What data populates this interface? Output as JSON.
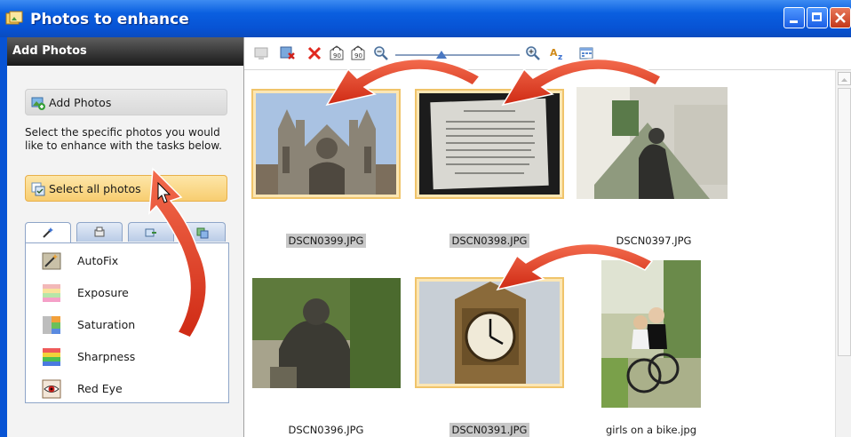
{
  "window": {
    "title": "Photos to enhance"
  },
  "left_panel": {
    "header": "Add Photos",
    "add_photos_label": "Add Photos",
    "description": "Select the specific photos you would like to enhance with the tasks below.",
    "select_all_label": "Select all photos",
    "tasks": [
      "AutoFix",
      "Exposure",
      "Saturation",
      "Sharpness",
      "Red Eye"
    ]
  },
  "photos": [
    {
      "name": "DSCN0399.JPG",
      "selected": true
    },
    {
      "name": "DSCN0398.JPG",
      "selected": true
    },
    {
      "name": "DSCN0397.JPG",
      "selected": false
    },
    {
      "name": "DSCN0396.JPG",
      "selected": false
    },
    {
      "name": "DSCN0391.JPG",
      "selected": true
    },
    {
      "name": "girls on a bike.jpg",
      "selected": false
    }
  ],
  "colors": {
    "title_bar": "#0753d4",
    "selection": "#f0c46a",
    "arrow": "#e8432a"
  },
  "icons": [
    "photo-icon",
    "remove-icon",
    "delete-icon",
    "rotate-left-icon",
    "rotate-right-icon",
    "zoom-out-icon",
    "zoom-in-icon",
    "sort-icon",
    "view-icon"
  ]
}
